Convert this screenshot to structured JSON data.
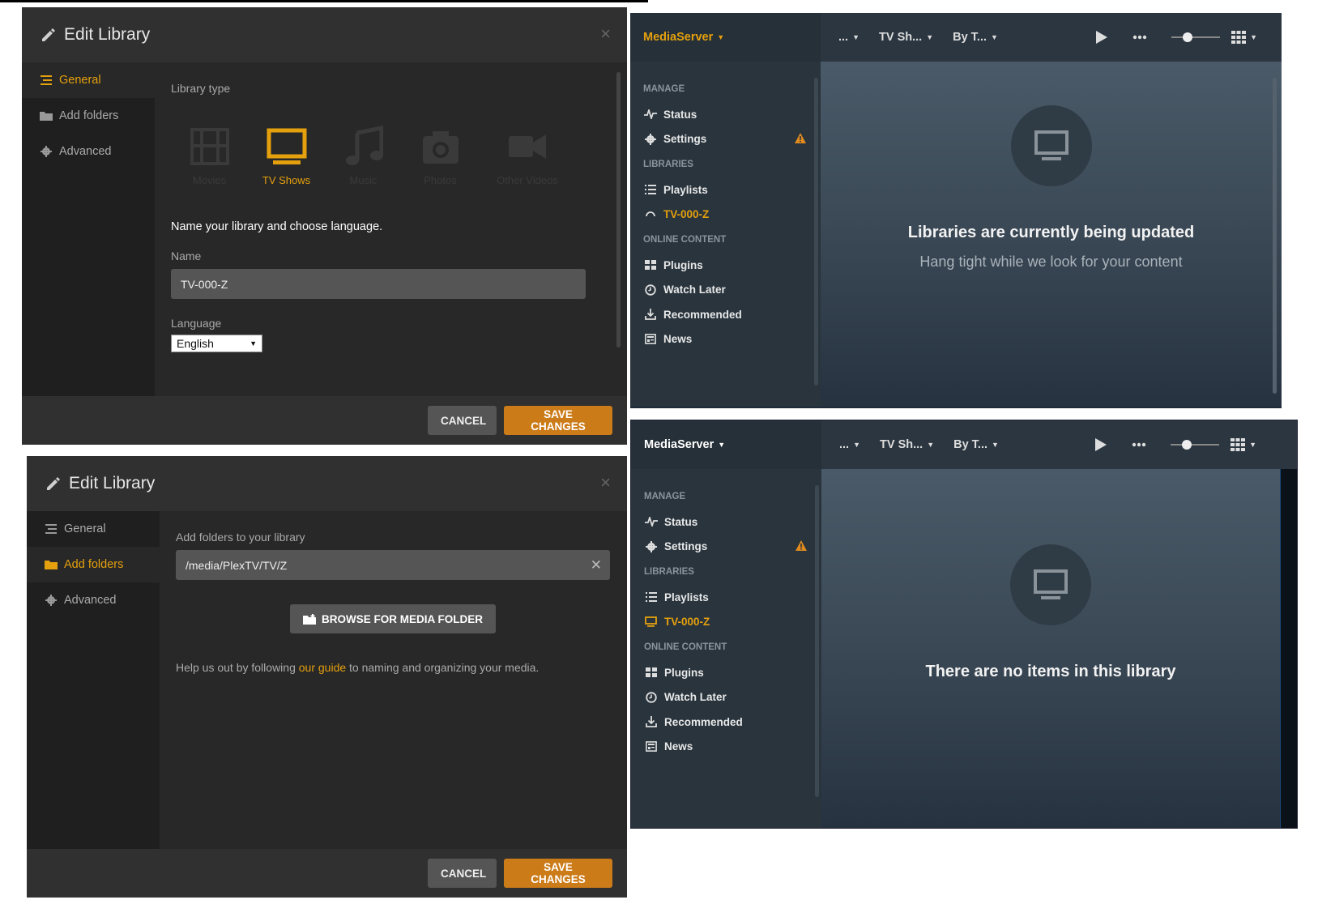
{
  "dialog_general": {
    "title": "Edit Library",
    "close": "×",
    "sidebar": [
      {
        "label": "General",
        "icon": "list-icon",
        "active": true
      },
      {
        "label": "Add folders",
        "icon": "folder-icon",
        "active": false
      },
      {
        "label": "Advanced",
        "icon": "gear-icon",
        "active": false
      }
    ],
    "library_type_label": "Library type",
    "library_types": [
      {
        "label": "Movies",
        "icon": "film-icon",
        "active": false
      },
      {
        "label": "TV Shows",
        "icon": "tv-icon",
        "active": true
      },
      {
        "label": "Music",
        "icon": "music-icon",
        "active": false
      },
      {
        "label": "Photos",
        "icon": "camera-icon",
        "active": false
      },
      {
        "label": "Other Videos",
        "icon": "video-camera-icon",
        "active": false
      }
    ],
    "name_heading": "Name your library and choose language.",
    "name_label": "Name",
    "name_value": "TV-000-Z",
    "language_label": "Language",
    "language_value": "English",
    "cancel": "CANCEL",
    "save": "SAVE CHANGES"
  },
  "dialog_folders": {
    "title": "Edit Library",
    "close": "×",
    "sidebar": [
      {
        "label": "General",
        "icon": "list-icon",
        "active": false
      },
      {
        "label": "Add folders",
        "icon": "folder-icon",
        "active": true
      },
      {
        "label": "Advanced",
        "icon": "gear-icon",
        "active": false
      }
    ],
    "folders_label": "Add folders to your library",
    "folder_path": "/media/PlexTV/TV/Z",
    "remove": "✕",
    "browse": "BROWSE FOR MEDIA FOLDER",
    "help_before": "Help us out by following ",
    "help_link": "our guide",
    "help_after": " to naming and organizing your media.",
    "cancel": "CANCEL",
    "save": "SAVE CHANGES"
  },
  "mediaserver_updating": {
    "brand": "MediaServer",
    "nav": [
      "...",
      "TV Sh...",
      "By T..."
    ],
    "sections": {
      "manage": "MANAGE",
      "libraries": "LIBRARIES",
      "online": "ONLINE CONTENT"
    },
    "manage_items": [
      "Status",
      "Settings"
    ],
    "library_items": [
      "Playlists",
      "TV-000-Z"
    ],
    "online_items": [
      "Plugins",
      "Watch Later",
      "Recommended",
      "News"
    ],
    "message_title": "Libraries are currently being updated",
    "message_sub": "Hang tight while we look for your content",
    "brand_color": "#e5a00d"
  },
  "mediaserver_empty": {
    "brand": "MediaServer",
    "nav": [
      "...",
      "TV Sh...",
      "By T..."
    ],
    "sections": {
      "manage": "MANAGE",
      "libraries": "LIBRARIES",
      "online": "ONLINE CONTENT"
    },
    "manage_items": [
      "Status",
      "Settings"
    ],
    "library_items": [
      "Playlists",
      "TV-000-Z"
    ],
    "online_items": [
      "Plugins",
      "Watch Later",
      "Recommended",
      "News"
    ],
    "message_title": "There are no items in this library"
  },
  "colors": {
    "accent": "#e5a00d",
    "save_button": "#cc7b19",
    "warning": "#e08a1e"
  }
}
